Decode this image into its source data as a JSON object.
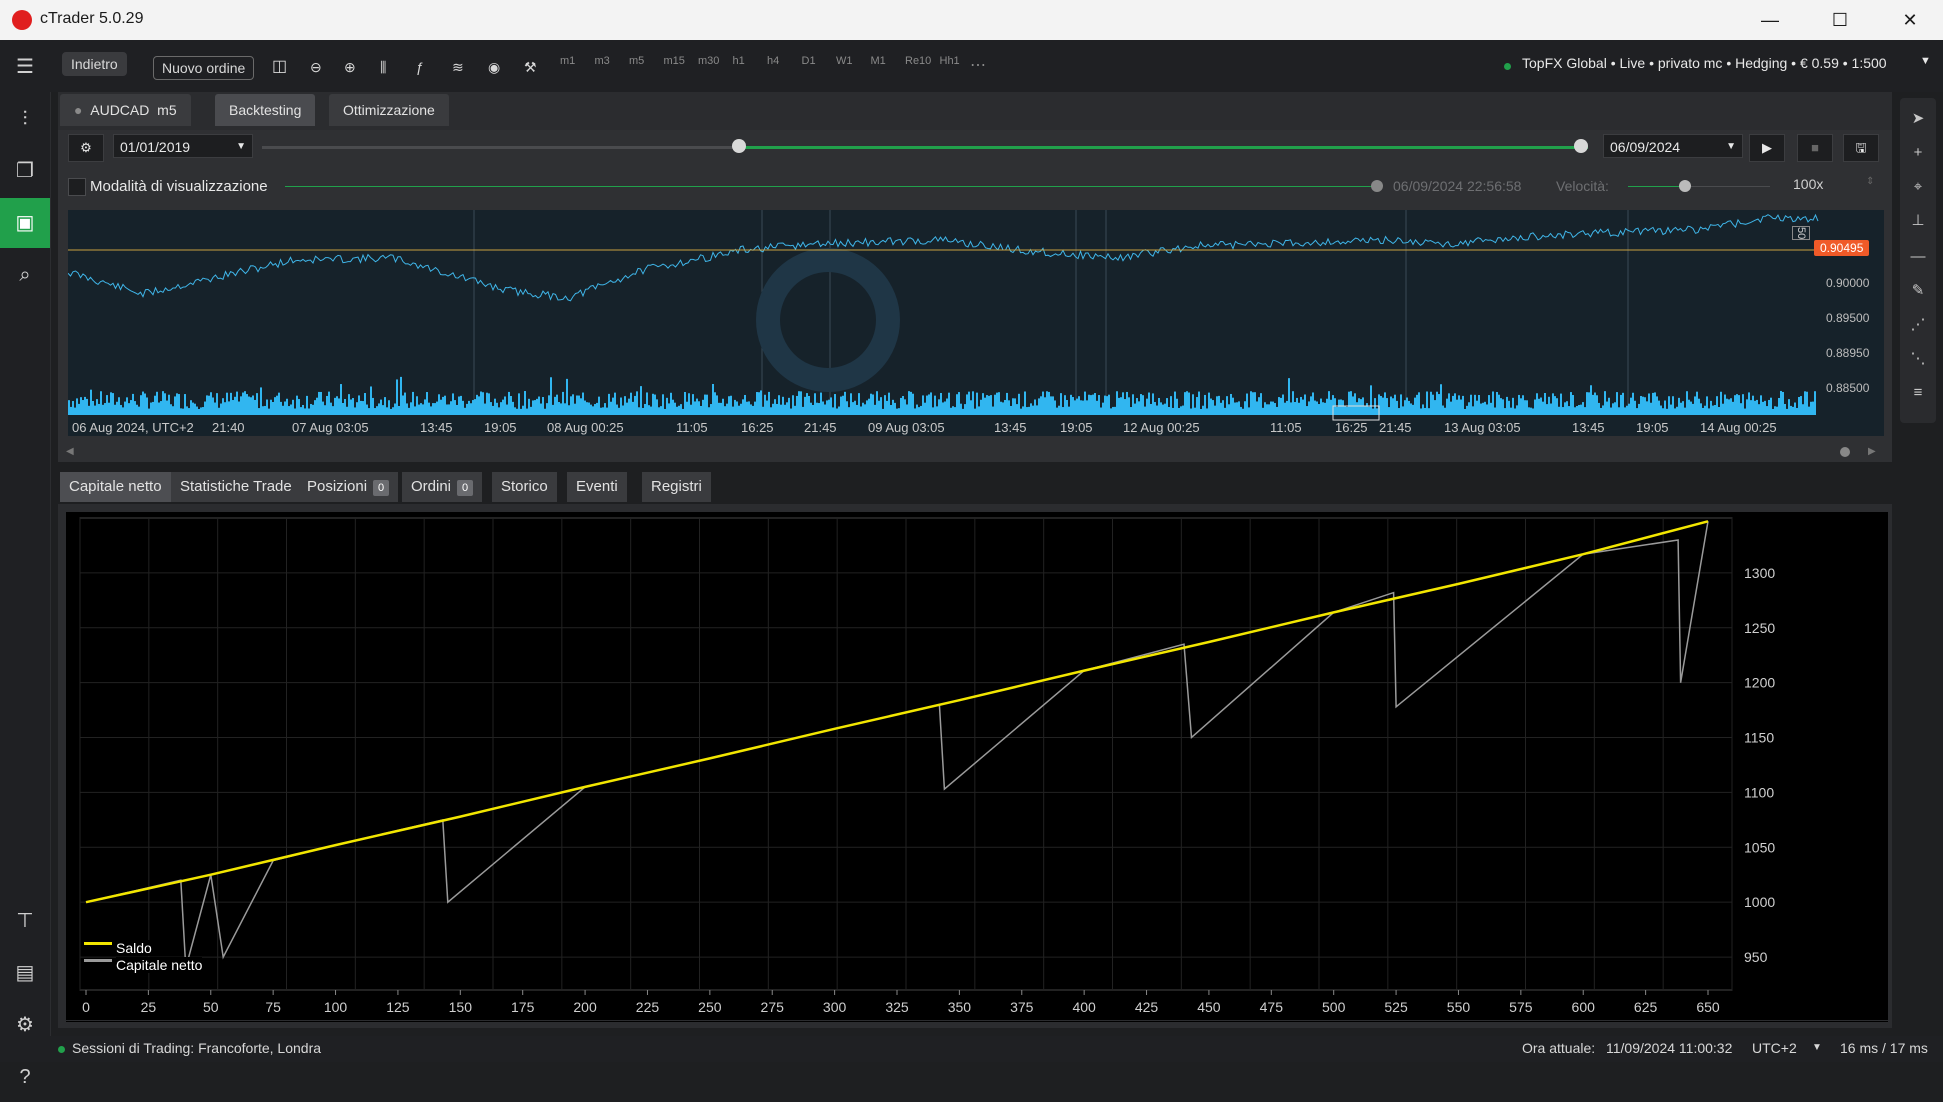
{
  "app": {
    "title": "cTrader 5.0.29"
  },
  "toolbar": {
    "back": "Indietro",
    "new_order": "Nuovo ordine",
    "timeframes": [
      "m1",
      "m3",
      "m5",
      "m15",
      "m30",
      "h1",
      "h4",
      "D1",
      "W1",
      "M1",
      "Re10",
      "Hh1"
    ],
    "more": "⋯",
    "account": "TopFX Global • Live • privato mc • Hedging • € 0.59 • 1:500"
  },
  "panel_tabs": {
    "symbol": "AUDCAD",
    "timeframe": "m5",
    "backtesting": "Backtesting",
    "optimization": "Ottimizzazione"
  },
  "backtest": {
    "start_date": "01/01/2019",
    "end_date": "06/09/2024",
    "range_start": 0.36,
    "range_end": 1.0,
    "visual_mode_label": "Modalità di visualizzazione",
    "visual_timestamp": "06/09/2024 22:56:58",
    "speed_label": "Velocità:",
    "speed_value": "100x",
    "speed_fraction": 0.4
  },
  "price_chart": {
    "current_price": "0.90495",
    "price_labels": [
      "0.90000",
      "0.89500",
      "0.88950",
      "0.88500"
    ],
    "time_labels": [
      "06 Aug 2024, UTC+2",
      "21:40",
      "07 Aug 03:05",
      "13:45",
      "19:05",
      "08 Aug 00:25",
      "11:05",
      "16:25",
      "21:45",
      "09 Aug 03:05",
      "13:45",
      "19:05",
      "12 Aug 00:25",
      "11:05",
      "16:25",
      "21:45",
      "13 Aug 03:05",
      "13:45",
      "19:05",
      "14 Aug 00:25"
    ],
    "scale_badge": "50",
    "colors": {
      "line": "#3fb5e8",
      "volume": "#31b6f0",
      "price_line": "#c8a040",
      "price_tag": "#f05a28"
    }
  },
  "results_tabs": [
    {
      "label": "Capitale netto"
    },
    {
      "label": "Statistiche Trade"
    },
    {
      "label": "Posizioni",
      "badge": "0"
    },
    {
      "label": "Ordini",
      "badge": "0"
    },
    {
      "label": "Storico"
    },
    {
      "label": "Eventi"
    },
    {
      "label": "Registri"
    }
  ],
  "chart_data": {
    "type": "line",
    "x_range": [
      0,
      650
    ],
    "y_range": [
      920,
      1350
    ],
    "x_ticks": [
      0,
      25,
      50,
      75,
      100,
      125,
      150,
      175,
      200,
      225,
      250,
      275,
      300,
      325,
      350,
      375,
      400,
      425,
      450,
      475,
      500,
      525,
      550,
      575,
      600,
      625,
      650
    ],
    "y_ticks": [
      950,
      1000,
      1050,
      1100,
      1150,
      1200,
      1250,
      1300
    ],
    "grid": true,
    "legend_position": "bottom-left",
    "series": [
      {
        "name": "Saldo",
        "color": "#f2e600",
        "x": [
          0,
          50,
          100,
          150,
          200,
          250,
          300,
          350,
          400,
          450,
          500,
          550,
          600,
          650
        ],
        "y": [
          1000,
          1025,
          1052,
          1078,
          1105,
          1131,
          1158,
          1184,
          1211,
          1237,
          1264,
          1290,
          1317,
          1347
        ]
      },
      {
        "name": "Capitale netto",
        "color": "#9a9a9a",
        "x": [
          0,
          38,
          40,
          50,
          55,
          75,
          100,
          143,
          145,
          200,
          250,
          300,
          342,
          344,
          400,
          440,
          443,
          500,
          524,
          525,
          600,
          638,
          639,
          650
        ],
        "y": [
          1000,
          1020,
          940,
          1025,
          950,
          1038,
          1052,
          1075,
          1000,
          1105,
          1131,
          1158,
          1180,
          1103,
          1211,
          1235,
          1150,
          1264,
          1282,
          1178,
          1317,
          1330,
          1200,
          1347
        ]
      }
    ]
  },
  "status": {
    "sessions": "Sessioni di Trading: Francoforte, Londra",
    "time_label": "Ora attuale:",
    "time_value": "11/09/2024 11:00:32",
    "tz": "UTC+2",
    "latency": "16 ms / 17 ms"
  }
}
